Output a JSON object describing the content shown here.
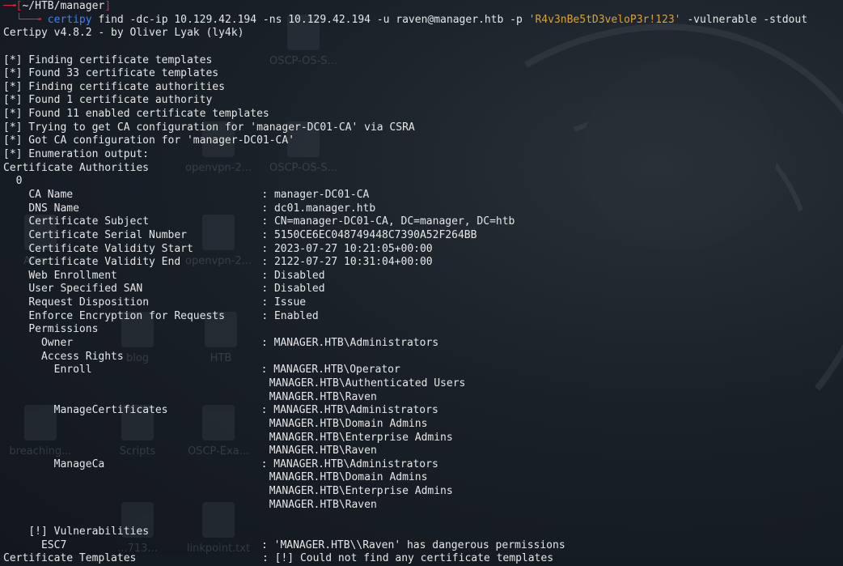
{
  "desktop": {
    "icons": [
      "OSCP-OS-S...",
      "openvpn-2...",
      "OSCP-OS-S...",
      "Adm...",
      "openvpn-2...",
      "blog",
      "HTB",
      "breaching...",
      "Scripts",
      "OSCP-Exa...",
      "linkpoint.txt",
      "...713..."
    ]
  },
  "prompt": {
    "path": "~/HTB/manager",
    "command": "certipy",
    "args": "find -dc-ip 10.129.42.194 -ns 10.129.42.194 -u raven@manager.htb -p",
    "password": "'R4v3nBe5tD3veloP3r!123'",
    "flags": "-vulnerable -stdout"
  },
  "banner": "Certipy v4.8.2 - by Oliver Lyak (ly4k)",
  "status": [
    "[*] Finding certificate templates",
    "[*] Found 33 certificate templates",
    "[*] Finding certificate authorities",
    "[*] Found 1 certificate authority",
    "[*] Found 11 enabled certificate templates",
    "[*] Trying to get CA configuration for 'manager-DC01-CA' via CSRA",
    "[*] Got CA configuration for 'manager-DC01-CA'",
    "[*] Enumeration output:"
  ],
  "ca_header": "Certificate Authorities",
  "ca_index": "0",
  "ca_fields": [
    {
      "k": "CA Name",
      "v": "manager-DC01-CA"
    },
    {
      "k": "DNS Name",
      "v": "dc01.manager.htb"
    },
    {
      "k": "Certificate Subject",
      "v": "CN=manager-DC01-CA, DC=manager, DC=htb"
    },
    {
      "k": "Certificate Serial Number",
      "v": "5150CE6EC048749448C7390A52F264BB"
    },
    {
      "k": "Certificate Validity Start",
      "v": "2023-07-27 10:21:05+00:00"
    },
    {
      "k": "Certificate Validity End",
      "v": "2122-07-27 10:31:04+00:00"
    },
    {
      "k": "Web Enrollment",
      "v": "Disabled"
    },
    {
      "k": "User Specified SAN",
      "v": "Disabled"
    },
    {
      "k": "Request Disposition",
      "v": "Issue"
    },
    {
      "k": "Enforce Encryption for Requests",
      "v": "Enabled"
    }
  ],
  "permissions": {
    "label": "Permissions",
    "owner_label": "Owner",
    "owner": "MANAGER.HTB\\Administrators",
    "access_rights_label": "Access Rights",
    "enroll_label": "Enroll",
    "enroll": [
      "MANAGER.HTB\\Operator",
      "MANAGER.HTB\\Authenticated Users",
      "MANAGER.HTB\\Raven"
    ],
    "managecerts_label": "ManageCertificates",
    "managecerts": [
      "MANAGER.HTB\\Administrators",
      "MANAGER.HTB\\Domain Admins",
      "MANAGER.HTB\\Enterprise Admins",
      "MANAGER.HTB\\Raven"
    ],
    "manageca_label": "ManageCa",
    "manageca": [
      "MANAGER.HTB\\Administrators",
      "MANAGER.HTB\\Domain Admins",
      "MANAGER.HTB\\Enterprise Admins",
      "MANAGER.HTB\\Raven"
    ]
  },
  "vulns": {
    "label": "[!] Vulnerabilities",
    "name": "ESC7",
    "detail": "'MANAGER.HTB\\\\Raven' has dangerous permissions"
  },
  "templates": {
    "label": "Certificate Templates",
    "detail": "[!] Could not find any certificate templates"
  }
}
